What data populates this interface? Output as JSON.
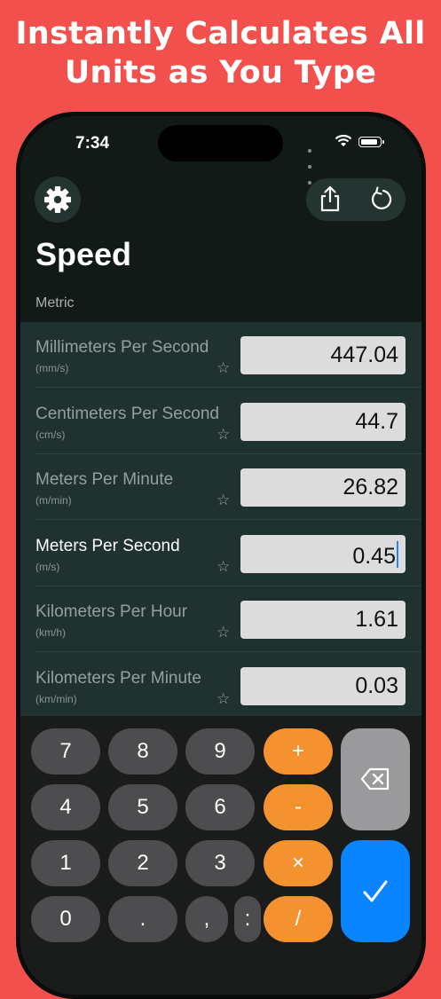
{
  "headline": {
    "line1": "Instantly Calculates All",
    "line2": "Units as You Type"
  },
  "status_bar": {
    "time": "7:34"
  },
  "toolbar": {
    "settings_icon": "gear-icon",
    "share_icon": "share-icon",
    "reset_icon": "reset-icon"
  },
  "page": {
    "title": "Speed",
    "section": "Metric"
  },
  "units": [
    {
      "name": "Millimeters Per Second",
      "abbr": "(mm/s)",
      "value": "447.04",
      "star": "☆"
    },
    {
      "name": "Centimeters Per Second",
      "abbr": "(cm/s)",
      "value": "44.7",
      "star": "☆"
    },
    {
      "name": "Meters Per Minute",
      "abbr": "(m/min)",
      "value": "26.82",
      "star": "☆"
    },
    {
      "name": "Meters Per Second",
      "abbr": "(m/s)",
      "value": "0.45",
      "star": "☆"
    },
    {
      "name": "Kilometers Per Hour",
      "abbr": "(km/h)",
      "value": "1.61",
      "star": "☆"
    },
    {
      "name": "Kilometers Per Minute",
      "abbr": "(km/min)",
      "value": "0.03",
      "star": "☆"
    }
  ],
  "keypad": {
    "digits": [
      "7",
      "8",
      "9",
      "4",
      "5",
      "6",
      "1",
      "2",
      "3",
      "0",
      ".",
      ",",
      ":"
    ],
    "ops": [
      "+",
      "-",
      "×",
      "/"
    ],
    "backspace_icon": "backspace-icon",
    "done_icon": "checkmark-icon"
  },
  "colors": {
    "background": "#f2504c",
    "operator": "#f4922f",
    "done": "#0a84ff",
    "list": "#203230"
  }
}
